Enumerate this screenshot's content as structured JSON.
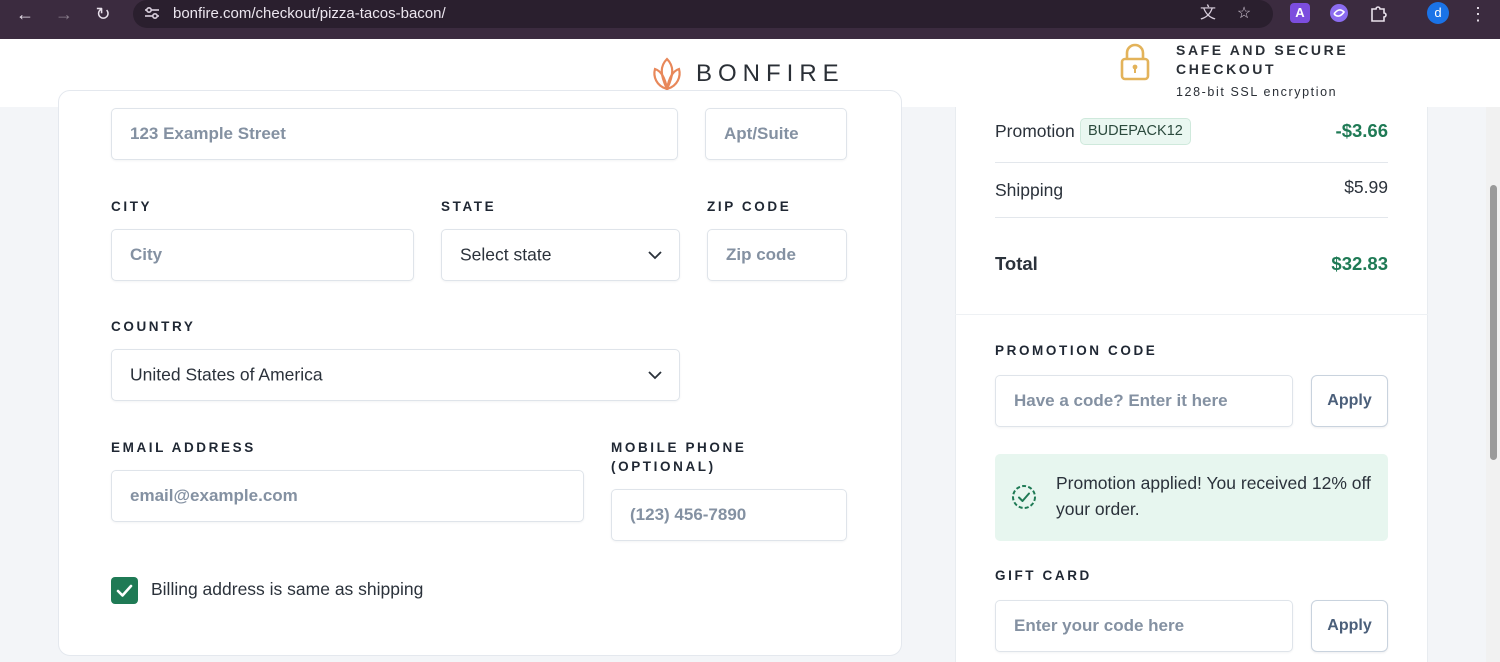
{
  "browser": {
    "url": "bonfire.com/checkout/pizza-tacos-bacon/",
    "profile_initial": "d",
    "extension_a_label": "A",
    "icons": [
      "back-icon",
      "forward-icon",
      "reload-icon",
      "site-info-icon",
      "translate-icon",
      "star-icon",
      "extension-a-icon",
      "extension-swirl-icon",
      "extensions-puzzle-icon",
      "more-vert-icon"
    ]
  },
  "header": {
    "brand": "BONFIRE",
    "secure_title": "SAFE AND SECURE CHECKOUT",
    "secure_subtitle": "128-bit SSL encryption"
  },
  "form": {
    "address_placeholder": "123 Example Street",
    "apt_placeholder": "Apt/Suite",
    "city_label": "CITY",
    "city_placeholder": "City",
    "state_label": "STATE",
    "state_value": "Select state",
    "zip_label": "ZIP CODE",
    "zip_placeholder": "Zip code",
    "country_label": "COUNTRY",
    "country_value": "United States of America",
    "email_label": "EMAIL ADDRESS",
    "email_placeholder": "email@example.com",
    "phone_label": "MOBILE PHONE (OPTIONAL)",
    "phone_placeholder": "(123) 456-7890",
    "billing_same_label": "Billing address is same as shipping",
    "billing_same_checked": true
  },
  "summary": {
    "promotion_label": "Promotion",
    "promotion_code": "BUDEPACK12",
    "promotion_amount": "-$3.66",
    "shipping_label": "Shipping",
    "shipping_amount": "$5.99",
    "total_label": "Total",
    "total_amount": "$32.83",
    "promo_code_label": "PROMOTION CODE",
    "promo_code_placeholder": "Have a code? Enter it here",
    "apply_label": "Apply",
    "promo_applied_text": "Promotion applied! You received 12% off your order.",
    "gift_card_label": "GIFT CARD",
    "gift_card_placeholder": "Enter your code here",
    "gift_apply_label": "Apply"
  },
  "colors": {
    "accent_green": "#1f7a55",
    "brand_orange": "#e8885a",
    "lock_gold": "#e3b35a",
    "chrome_bg": "#3b2b3f"
  }
}
